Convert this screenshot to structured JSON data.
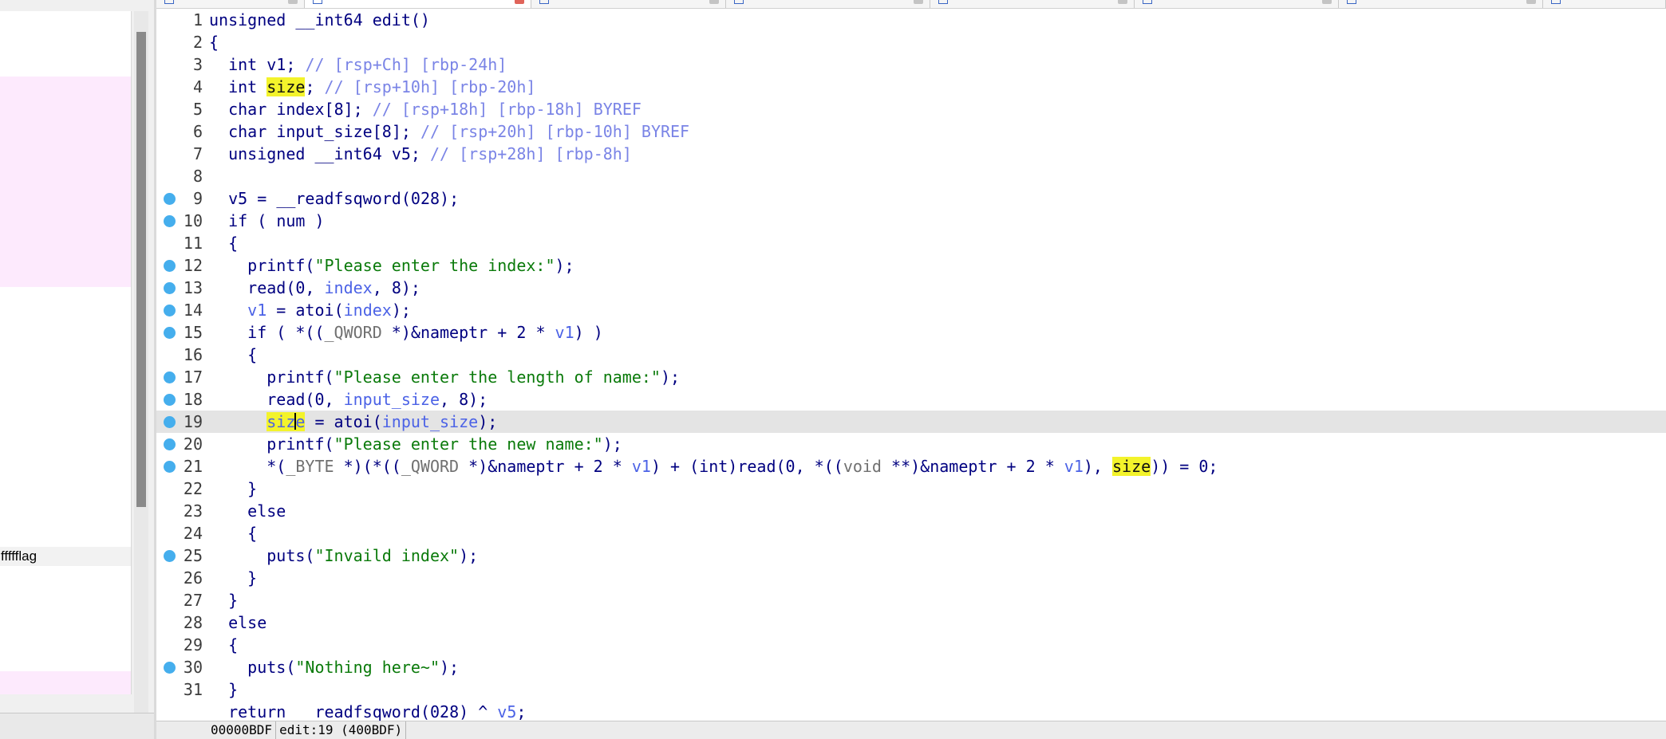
{
  "left_panel": {
    "highlighted_item": "ffffflag"
  },
  "tabs": [
    {
      "id": "ida-view",
      "active": false
    },
    {
      "id": "pseudocode",
      "active": true
    },
    {
      "id": "strings",
      "active": false
    },
    {
      "id": "hex-view",
      "active": false
    },
    {
      "id": "structures",
      "active": false
    },
    {
      "id": "enums",
      "active": false
    },
    {
      "id": "imports",
      "active": false
    },
    {
      "id": "exports",
      "active": false
    }
  ],
  "code": {
    "lines": [
      {
        "n": "1",
        "bp": false,
        "text": "unsigned __int64 edit()"
      },
      {
        "n": "2",
        "bp": false,
        "text": "{"
      },
      {
        "n": "3",
        "bp": false,
        "text": "  int v1; // [rsp+Ch] [rbp-24h]"
      },
      {
        "n": "4",
        "bp": false,
        "text": "  int size; // [rsp+10h] [rbp-20h]"
      },
      {
        "n": "5",
        "bp": false,
        "text": "  char index[8]; // [rsp+18h] [rbp-18h] BYREF"
      },
      {
        "n": "6",
        "bp": false,
        "text": "  char input_size[8]; // [rsp+20h] [rbp-10h] BYREF"
      },
      {
        "n": "7",
        "bp": false,
        "text": "  unsigned __int64 v5; // [rsp+28h] [rbp-8h]"
      },
      {
        "n": "8",
        "bp": false,
        "text": ""
      },
      {
        "n": "9",
        "bp": true,
        "text": "  v5 = __readfsqword(0x28u);"
      },
      {
        "n": "10",
        "bp": true,
        "text": "  if ( num )"
      },
      {
        "n": "11",
        "bp": false,
        "text": "  {"
      },
      {
        "n": "12",
        "bp": true,
        "text": "    printf(\"Please enter the index:\");"
      },
      {
        "n": "13",
        "bp": true,
        "text": "    read(0, index, 8uLL);"
      },
      {
        "n": "14",
        "bp": true,
        "text": "    v1 = atoi(index);"
      },
      {
        "n": "15",
        "bp": true,
        "text": "    if ( *((_QWORD *)&nameptr + 2 * v1) )"
      },
      {
        "n": "16",
        "bp": false,
        "text": "    {"
      },
      {
        "n": "17",
        "bp": true,
        "text": "      printf(\"Please enter the length of name:\");"
      },
      {
        "n": "18",
        "bp": true,
        "text": "      read(0, input_size, 8uLL);"
      },
      {
        "n": "19",
        "bp": true,
        "text": "      size = atoi(input_size);"
      },
      {
        "n": "20",
        "bp": true,
        "text": "      printf(\"Please enter the new name:\");"
      },
      {
        "n": "21",
        "bp": true,
        "text": "      *(_BYTE *)(*((_QWORD *)&nameptr + 2 * v1) + (int)read(0, *((void **)&nameptr + 2 * v1), size)) = 0;"
      },
      {
        "n": "22",
        "bp": false,
        "text": "    }"
      },
      {
        "n": "23",
        "bp": false,
        "text": "    else"
      },
      {
        "n": "24",
        "bp": false,
        "text": "    {"
      },
      {
        "n": "25",
        "bp": true,
        "text": "      puts(\"Invaild index\");"
      },
      {
        "n": "26",
        "bp": false,
        "text": "    }"
      },
      {
        "n": "27",
        "bp": false,
        "text": "  }"
      },
      {
        "n": "28",
        "bp": false,
        "text": "  else"
      },
      {
        "n": "29",
        "bp": false,
        "text": "  {"
      },
      {
        "n": "30",
        "bp": true,
        "text": "    puts(\"Nothing here~\");"
      },
      {
        "n": "31",
        "bp": false,
        "text": "  }"
      },
      {
        "n": "",
        "bp": false,
        "text": "  return __readfsqword(0x28u) ^ v5;"
      }
    ],
    "current_line": "19",
    "highlight_word": "size"
  },
  "status": {
    "address": "00000BDF",
    "location": "edit:19 (400BDF)"
  },
  "colors": {
    "keyword": "#000080",
    "comment": "#7a84e6",
    "string": "#0a7a0a",
    "variable": "#4b62e6",
    "highlight": "#f3f32b",
    "breakpoint": "#45aeed",
    "current_line": "#e4e4e4"
  }
}
